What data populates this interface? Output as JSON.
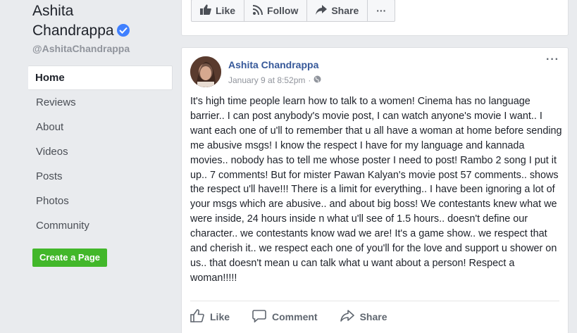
{
  "sidebar": {
    "page_name_line1": "Ashita",
    "page_name_line2": "Chandrappa",
    "username": "@AshitaChandrappa",
    "nav": [
      {
        "label": "Home",
        "active": true
      },
      {
        "label": "Reviews"
      },
      {
        "label": "About"
      },
      {
        "label": "Videos"
      },
      {
        "label": "Posts"
      },
      {
        "label": "Photos"
      },
      {
        "label": "Community"
      }
    ],
    "create_page_label": "Create a Page"
  },
  "action_bar": {
    "like_label": "Like",
    "follow_label": "Follow",
    "share_label": "Share",
    "more_label": "···"
  },
  "post": {
    "author": "Ashita Chandrappa",
    "timestamp": "January 9 at 8:52pm",
    "separator": "·",
    "options_label": "···",
    "text": "It's high time people learn how to talk to a women! Cinema has no language barrier.. I can post anybody's movie post, I can watch anyone's movie I want.. I want each one of u'll to remember that u all have a woman at home before sending me abusive msgs! I know the respect I have for my language and kannada movies.. nobody has to tell me whose poster I need to post! Rambo 2 song I put it up.. 7 comments! But for mister Pawan Kalyan's movie post 57 comments.. shows the respect u'll have!!! There is a limit for everything.. I have been ignoring a lot of your msgs which are abusive.. and about big boss! We contestants knew what we were inside, 24 hours inside n what u'll see of 1.5 hours.. doesn't define our character.. we contestants know wad we are! It's a game show.. we respect that and cherish it.. we respect each one of you'll for the love and support u shower on us.. that doesn't mean u can talk what u want about a person! Respect a woman!!!!!",
    "actions": {
      "like_label": "Like",
      "comment_label": "Comment",
      "share_label": "Share"
    }
  },
  "colors": {
    "link_blue": "#365899",
    "verified_blue": "#4080ff",
    "create_green": "#42b72a",
    "background": "#e9ebee"
  }
}
